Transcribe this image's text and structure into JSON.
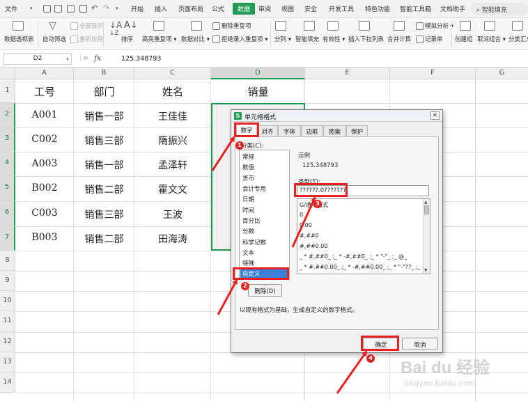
{
  "menu": {
    "items": [
      "文件",
      "开始",
      "插入",
      "页面布局",
      "公式",
      "数据",
      "审阅",
      "视图",
      "安全",
      "开发工具",
      "特色功能",
      "智能工具箱",
      "文档助手"
    ],
    "search": "智能填充"
  },
  "ribbon": {
    "pivot": "数据透视表",
    "autofilter": "自动筛选",
    "show_all": "全部显示",
    "reapply": "重新应用",
    "sort": "排序",
    "highlight_dup": "高亮重复项",
    "data_compare": "数据对比",
    "delete_dup": "删除重复项",
    "reject_dup": "拒绝录入重复项",
    "split": "分列",
    "smart_fill": "智能填充",
    "validity": "有效性",
    "insert_dropdown": "插入下拉列表",
    "consolidate": "合并计算",
    "simulate": "模拟分析",
    "record": "记录单",
    "create_group": "创建组",
    "ungroup": "取消组合",
    "subtotal": "分类汇总"
  },
  "formula_bar": {
    "cell_ref": "D2",
    "fx": "fx",
    "value": "125.348793"
  },
  "columns": [
    "A",
    "B",
    "C",
    "D",
    "E",
    "F",
    "G"
  ],
  "rows": [
    "1",
    "2",
    "3",
    "4",
    "5",
    "6",
    "7",
    "8",
    "9",
    "10",
    "11",
    "12",
    "13",
    "14"
  ],
  "table": {
    "headers": [
      "工号",
      "部门",
      "姓名",
      "销量"
    ],
    "data": [
      [
        "A001",
        "销售一部",
        "王佳佳"
      ],
      [
        "C002",
        "销售三部",
        "隋振兴"
      ],
      [
        "A003",
        "销售一部",
        "孟泽轩"
      ],
      [
        "B002",
        "销售二部",
        "霍文文"
      ],
      [
        "C003",
        "销售三部",
        "王波"
      ],
      [
        "B003",
        "销售二部",
        "田海涛"
      ]
    ]
  },
  "dialog": {
    "title": "单元格格式",
    "close": "✕",
    "tabs": [
      "数字",
      "对齐",
      "字体",
      "边框",
      "图案",
      "保护"
    ],
    "category_label": "分类(C):",
    "categories": [
      "常规",
      "数值",
      "货币",
      "会计专用",
      "日期",
      "时间",
      "百分比",
      "分数",
      "科学记数",
      "文本",
      "特殊",
      "自定义"
    ],
    "selected_category": "自定义",
    "delete_btn": "删除(D)",
    "sample_label": "示例",
    "sample_value": "125.348793",
    "type_label": "类型(T):",
    "type_value": "??????.0???????",
    "formats": [
      "G/通用格式",
      "0",
      "0.00",
      "#,##0",
      "#,##0.00",
      "_ * #,##0_ ;_ * -#,##0_ ;_ * \"-\"_ ;_ @_",
      "_ * #,##0.00_ ;_ * -#,##0.00_ ;_ * \"-\"??_ ;_ @_"
    ],
    "description": "以现有格式为基础，生成自定义的数字格式。",
    "ok": "确定",
    "cancel": "取消"
  },
  "annotations": {
    "colors": {
      "mark": "#e82222",
      "accent": "#1f9d55"
    },
    "badges": [
      "1",
      "2",
      "3",
      "4"
    ]
  },
  "watermark": {
    "logo": "Bai du 经验",
    "url": "jingyan.baidu.com"
  }
}
